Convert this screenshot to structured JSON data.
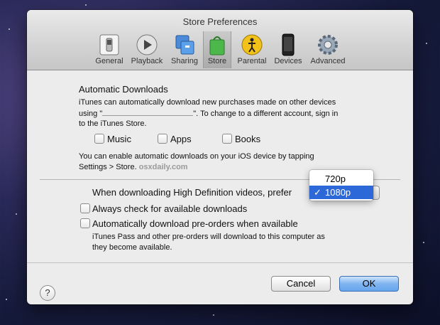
{
  "window": {
    "title": "Store Preferences"
  },
  "toolbar": {
    "items": [
      {
        "label": "General",
        "icon": "general-switch-icon"
      },
      {
        "label": "Playback",
        "icon": "playback-icon"
      },
      {
        "label": "Sharing",
        "icon": "sharing-icon"
      },
      {
        "label": "Store",
        "icon": "store-bag-icon",
        "selected": true
      },
      {
        "label": "Parental",
        "icon": "parental-icon"
      },
      {
        "label": "Devices",
        "icon": "devices-icon"
      },
      {
        "label": "Advanced",
        "icon": "advanced-gear-icon"
      }
    ]
  },
  "auto_downloads": {
    "heading": "Automatic Downloads",
    "desc_line1": "iTunes can automatically download new purchases made on other devices",
    "desc_line2_prefix": "using \"",
    "desc_line2_suffix": "\". To change to a different account, sign in",
    "desc_line3": "to the iTunes Store.",
    "checkboxes": [
      {
        "label": "Music",
        "checked": false
      },
      {
        "label": "Apps",
        "checked": false
      },
      {
        "label": "Books",
        "checked": false
      }
    ],
    "ios_line1": "You can enable automatic downloads on your iOS device by tapping",
    "ios_line2": "Settings > Store.",
    "watermark": "osxdaily.com"
  },
  "hd": {
    "label": "When downloading High Definition videos, prefer",
    "options": [
      "720p",
      "1080p"
    ],
    "selected": "1080p",
    "checkmark": "✓"
  },
  "options": {
    "always_check": "Always check for available downloads",
    "preorders": "Automatically download pre-orders when available",
    "preorders_note_line1": "iTunes Pass and other pre-orders will download to this computer as",
    "preorders_note_line2": "they become available."
  },
  "buttons": {
    "help": "?",
    "cancel": "Cancel",
    "ok": "OK"
  },
  "colors": {
    "selection": "#2d68d8",
    "default_button": "#67a6ee"
  }
}
